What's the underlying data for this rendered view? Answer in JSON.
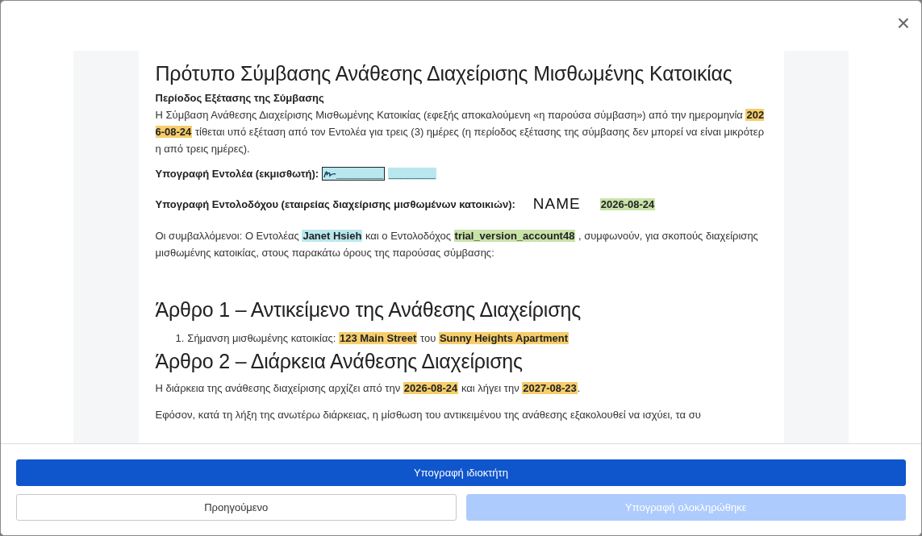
{
  "close": "×",
  "title": "Πρότυπο Σύμβασης Ανάθεσης Διαχείρισης Μισθωμένης Κατοικίας",
  "blocks": [
    {
      "kind": "subheading",
      "text": "Περίοδος Εξέτασης της Σύμβασης"
    },
    {
      "kind": "paragraph",
      "segments": [
        {
          "kind": "plain",
          "text": "Η Σύμβαση Ανάθεσης Διαχείρισης Μισθωμένης Κατοικίας (εφεξής αποκαλούμενη «η παρούσα σύμβαση») από την ημερομηνία "
        },
        {
          "kind": "field",
          "text": "2026-08-24",
          "color": "#f5cd6b"
        },
        {
          "kind": "plain",
          "text": "  τίθεται υπό εξέταση από τον Εντολέα για τρεις (3) ημέρες (η περίοδος εξέτασης της σύμβασης δεν μπορεί να είναι μικρότερη από τρεις ημέρες)."
        }
      ]
    },
    {
      "kind": "signature",
      "segments": [
        {
          "kind": "label",
          "text": "Υπογραφή Εντολέα (εκμισθωτή): "
        },
        {
          "kind": "signed",
          "text": "________",
          "color": "#b8e8ee"
        },
        {
          "kind": "field",
          "text": "________",
          "color": "#b8e8ee"
        }
      ]
    },
    {
      "kind": "signature",
      "segments": [
        {
          "kind": "label",
          "text": "Υπογραφή Εντολοδόχου (εταιρείας διαχείρισης μισθωμένων κατοικιών):"
        },
        {
          "kind": "name",
          "text": "NAME"
        },
        {
          "kind": "field",
          "text": "2026-08-24",
          "color": "#c8e2a8"
        }
      ]
    },
    {
      "kind": "paragraph",
      "segments": [
        {
          "kind": "plain",
          "text": "Οι συμβαλλόμενοι: Ο Εντολέας "
        },
        {
          "kind": "field",
          "text": "Janet Hsieh",
          "color": "#b8e8ee"
        },
        {
          "kind": "plain",
          "text": "  και ο Εντολοδόχος "
        },
        {
          "kind": "field",
          "text": "trial_version_account48",
          "color": "#c8e2a8"
        },
        {
          "kind": "plain",
          "text": " , συμφωνούν, για σκοπούς διαχείρισης μισθωμένης κατοικίας, στους παρακάτω όρους της παρούσας σύμβασης:"
        }
      ]
    },
    {
      "kind": "heading",
      "text": "Άρθρο 1 – Αντικείμενο της Ανάθεσης Διαχείρισης"
    },
    {
      "kind": "listitem",
      "number": "1.",
      "segments": [
        {
          "kind": "plain",
          "text": "Σήμανση μισθωμένης κατοικίας: "
        },
        {
          "kind": "field",
          "text": "123 Main Street",
          "color": "#f5cd6b"
        },
        {
          "kind": "plain",
          "text": "  του "
        },
        {
          "kind": "field",
          "text": "Sunny Heights Apartment",
          "color": "#f5cd6b"
        }
      ]
    },
    {
      "kind": "heading",
      "text": "Άρθρο 2 – Διάρκεια Ανάθεσης Διαχείρισης"
    },
    {
      "kind": "paragraph",
      "segments": [
        {
          "kind": "plain",
          "text": "Η διάρκεια της ανάθεσης διαχείρισης αρχίζει από την "
        },
        {
          "kind": "field",
          "text": "2026-08-24",
          "color": "#f5cd6b"
        },
        {
          "kind": "plain",
          "text": " και λήγει την "
        },
        {
          "kind": "field",
          "text": "2027-08-23",
          "color": "#f5cd6b"
        },
        {
          "kind": "plain",
          "text": "."
        }
      ]
    },
    {
      "kind": "paragraph",
      "segments": [
        {
          "kind": "plain",
          "text": "Εφόσον, κατά τη λήξη της ανωτέρω διάρκειας, η μίσθωση του αντικειμένου της ανάθεσης εξακολουθεί να ισχύει, τα συ"
        }
      ]
    }
  ],
  "buttons": [
    {
      "kind": "primary",
      "label": "Υπογραφή ιδιοκτήτη",
      "disabled": false
    },
    {
      "kind": "secondary",
      "label": "Προηγούμενο",
      "disabled": false
    },
    {
      "kind": "primary",
      "label": "Υπογραφή ολοκληρώθηκε",
      "disabled": true
    }
  ]
}
